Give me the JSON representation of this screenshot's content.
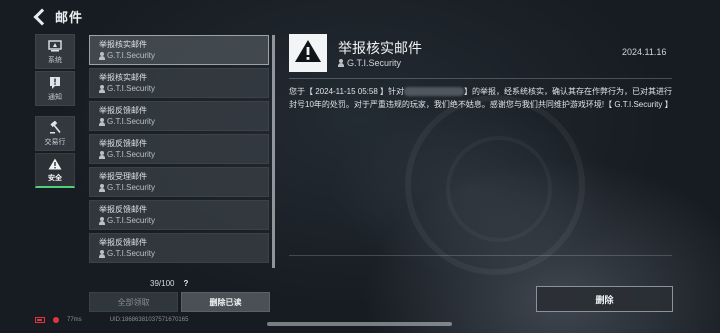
{
  "header": {
    "title": "邮件"
  },
  "nav": {
    "items": [
      {
        "label": "系统",
        "icon": "system-icon",
        "active": false
      },
      {
        "label": "通知",
        "icon": "notice-icon",
        "active": false
      },
      {
        "label": "交易行",
        "icon": "hammer-icon",
        "active": false
      },
      {
        "label": "安全",
        "icon": "warning-icon",
        "active": true
      }
    ]
  },
  "mail_list": {
    "items": [
      {
        "title": "举报核实邮件",
        "sender": "G.T.I.Security"
      },
      {
        "title": "举报核实邮件",
        "sender": "G.T.I.Security"
      },
      {
        "title": "举报反馈邮件",
        "sender": "G.T.I.Security"
      },
      {
        "title": "举报反馈邮件",
        "sender": "G.T.I.Security"
      },
      {
        "title": "举报受理邮件",
        "sender": "G.T.I.Security"
      },
      {
        "title": "举报反馈邮件",
        "sender": "G.T.I.Security"
      },
      {
        "title": "举报反馈邮件",
        "sender": "G.T.I.Security"
      }
    ],
    "count": "39/100",
    "help": "?",
    "collect_all_label": "全部领取",
    "delete_read_label": "删除已读"
  },
  "detail": {
    "title": "举报核实邮件",
    "sender": "G.T.I.Security",
    "date": "2024.11.16",
    "body_part1": "您于【 2024-11-15 05:58 】针对",
    "body_part2": "】的举报，经系统核实，确认其存在作弊行为，已对其进行封号10年的处罚。对于严重违规的玩家，我们绝不姑息。感谢您与我们共同维护游戏环境!【 G.T.I.Security 】",
    "delete_label": "删除"
  },
  "footer": {
    "ping": "77ms",
    "uid": "UID:18686381037571670165"
  },
  "colors": {
    "accent_green": "#4fd07a",
    "status_red": "#e0363b"
  }
}
